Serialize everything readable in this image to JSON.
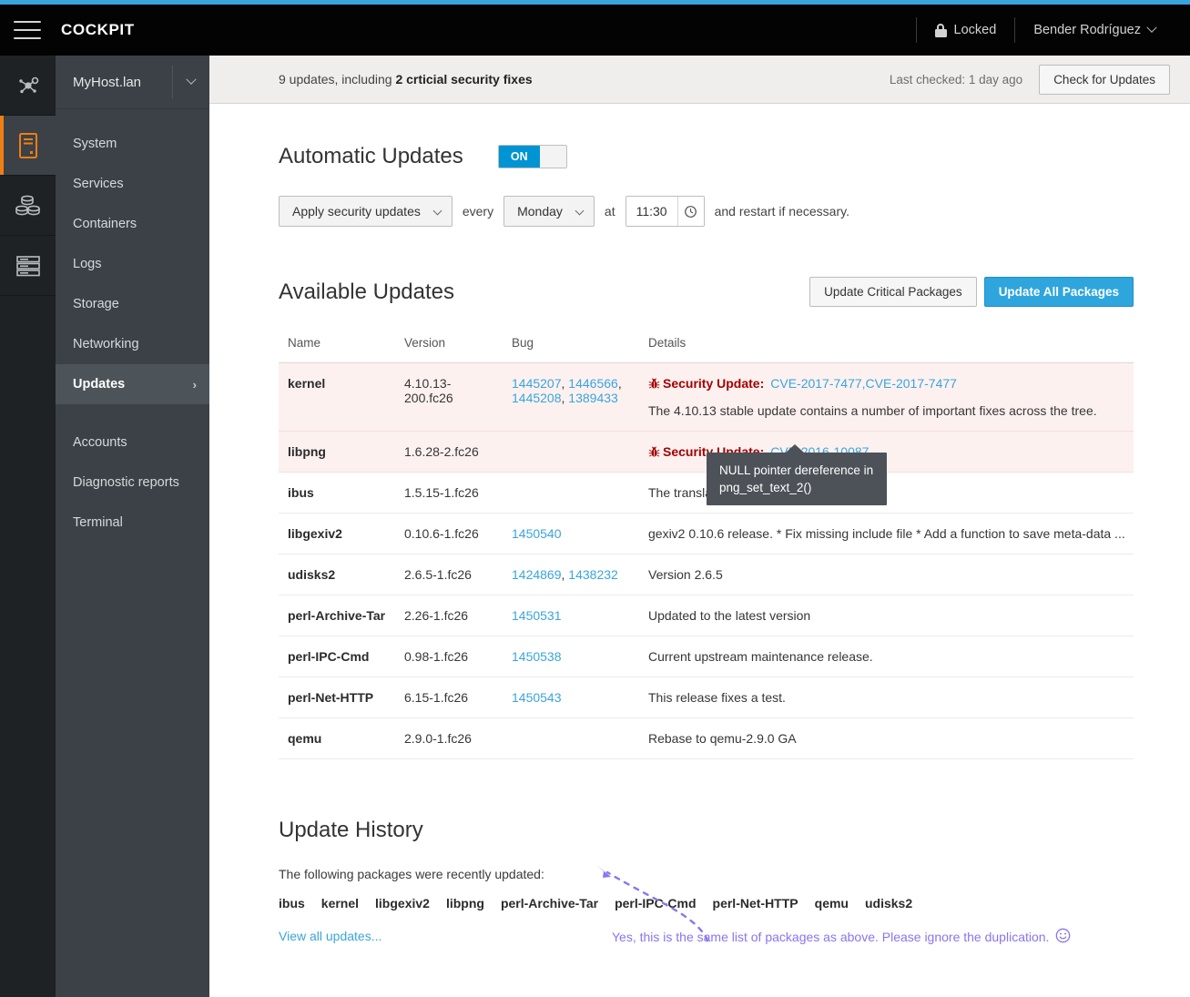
{
  "theme": {
    "accent_blue": "#39a5dc",
    "primary_button": "#2fa5dd",
    "active_orange": "#ef7e14",
    "security_red": "#a30000",
    "annotation_purple": "#8b74f0"
  },
  "masthead": {
    "brand": "COCKPIT",
    "hamburger_icon": "hamburger-menu-icon",
    "lock_icon": "lock-icon",
    "locked_label": "Locked",
    "user_label": "Bender Rodríguez",
    "user_caret_icon": "chevron-down-icon"
  },
  "rail": {
    "items": [
      {
        "name": "cluster-topology-icon",
        "active": false
      },
      {
        "name": "server-icon",
        "active": true
      },
      {
        "name": "containers-icon",
        "active": false
      },
      {
        "name": "rack-icon",
        "active": false
      }
    ]
  },
  "sidebar": {
    "host": "MyHost.lan",
    "host_caret_icon": "chevron-down-icon",
    "items": [
      {
        "label": "System",
        "active": false,
        "chevron": ""
      },
      {
        "label": "Services",
        "active": false,
        "chevron": ""
      },
      {
        "label": "Containers",
        "active": false,
        "chevron": ""
      },
      {
        "label": "Logs",
        "active": false,
        "chevron": ""
      },
      {
        "label": "Storage",
        "active": false,
        "chevron": ""
      },
      {
        "label": "Networking",
        "active": false,
        "chevron": ""
      },
      {
        "label": "Updates",
        "active": true,
        "chevron": "›"
      }
    ],
    "items2": [
      {
        "label": "Accounts"
      },
      {
        "label": "Diagnostic reports"
      },
      {
        "label": "Terminal"
      }
    ]
  },
  "notification": {
    "text_prefix": "9 updates, including ",
    "text_bold": "2 crticial security fixes",
    "last_checked": "Last checked: 1 day ago",
    "check_button": "Check for Updates"
  },
  "automatic_updates": {
    "title": "Automatic Updates",
    "toggle_state": "ON",
    "policy": "Apply security updates",
    "every_label": "every",
    "day": "Monday",
    "at_label": "at",
    "time": "11:30",
    "clock_icon": "clock-icon",
    "trailing_text": "and restart if necessary."
  },
  "available_updates": {
    "title": "Available Updates",
    "button_critical": "Update Critical Packages",
    "button_all": "Update All Packages",
    "columns": [
      "Name",
      "Version",
      "Bug",
      "Details"
    ],
    "rows": [
      {
        "name": "kernel",
        "version": "4.10.13-200.fc26",
        "bugs": [
          "1445207",
          "1446566",
          "1445208",
          "1389433"
        ],
        "security": true,
        "security_label": "Security Update:",
        "cves": "CVE-2017-7477,CVE-2017-7477",
        "details": "The 4.10.13 stable update contains a number of important fixes across the tree."
      },
      {
        "name": "libpng",
        "version": "1.6.28-2.fc26",
        "bugs": [],
        "security": true,
        "security_label": "Security Update:",
        "cves": "CVE-2016-10087",
        "details": ""
      },
      {
        "name": "ibus",
        "version": "1.5.15-1.fc26",
        "bugs": [],
        "security": false,
        "details": "The translation..."
      },
      {
        "name": "libgexiv2",
        "version": "0.10.6-1.fc26",
        "bugs": [
          "1450540"
        ],
        "security": false,
        "details": "gexiv2 0.10.6 release. * Fix missing include file * Add a function to save meta-data ..."
      },
      {
        "name": "udisks2",
        "version": "2.6.5-1.fc26",
        "bugs": [
          "1424869",
          "1438232"
        ],
        "security": false,
        "details": "Version 2.6.5"
      },
      {
        "name": "perl-Archive-Tar",
        "version": "2.26-1.fc26",
        "bugs": [
          "1450531"
        ],
        "security": false,
        "details": "Updated to the latest version"
      },
      {
        "name": "perl-IPC-Cmd",
        "version": "0.98-1.fc26",
        "bugs": [
          "1450538"
        ],
        "security": false,
        "details": "Current upstream maintenance release."
      },
      {
        "name": "perl-Net-HTTP",
        "version": "6.15-1.fc26",
        "bugs": [
          "1450543"
        ],
        "security": false,
        "details": "This release fixes a test."
      },
      {
        "name": "qemu",
        "version": "2.9.0-1.fc26",
        "bugs": [],
        "security": false,
        "details": "Rebase to qemu-2.9.0 GA"
      }
    ]
  },
  "tooltip": {
    "text": "NULL pointer dereference in png_set_text_2()"
  },
  "update_history": {
    "title": "Update History",
    "lead": "The following packages were recently updated:",
    "packages": [
      "ibus",
      "kernel",
      "libgexiv2",
      "libpng",
      "perl-Archive-Tar",
      "perl-IPC-Cmd",
      "perl-Net-HTTP",
      "qemu",
      "udisks2"
    ],
    "view_all": "View all updates..."
  },
  "annotation": {
    "text": "Yes, this is the same list of packages as above. Please ignore the duplication.",
    "emoji": "☺",
    "arrow_icon": "curved-dashed-arrow-icon"
  }
}
